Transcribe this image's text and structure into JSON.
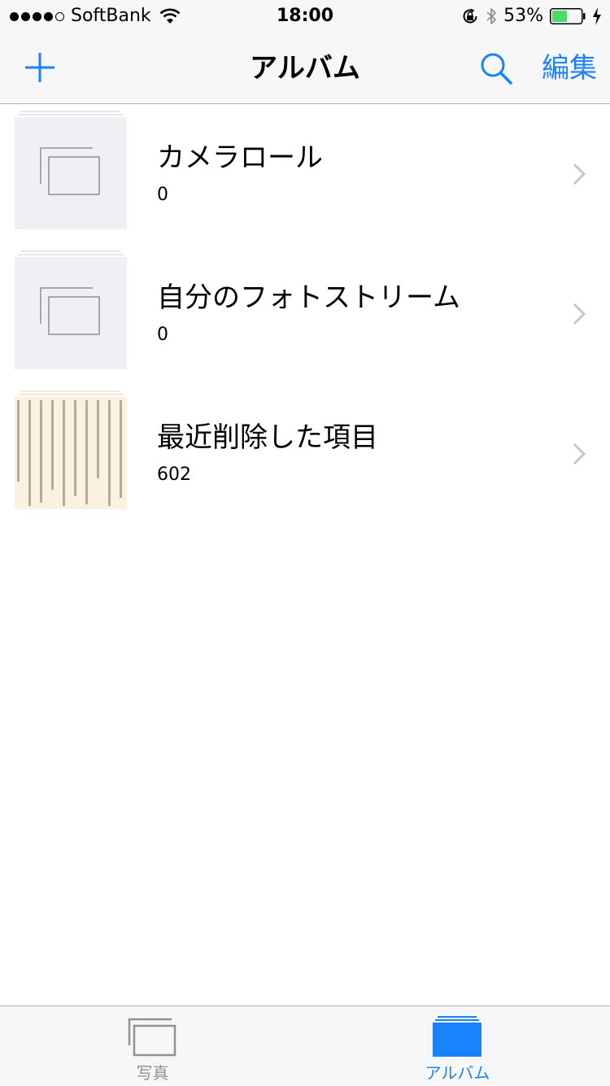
{
  "status_bar": {
    "carrier": "SoftBank",
    "time": "18:00",
    "battery_percent": "53%",
    "battery_level": 0.53,
    "signal_bars_filled": 4,
    "signal_bars_total": 5
  },
  "nav": {
    "title": "アルバム",
    "edit_label": "編集",
    "add_icon": "plus-icon",
    "search_icon": "search-icon"
  },
  "albums": [
    {
      "title": "カメラロール",
      "count": "0",
      "thumbnail": "placeholder"
    },
    {
      "title": "自分のフォトストリーム",
      "count": "0",
      "thumbnail": "placeholder"
    },
    {
      "title": "最近削除した項目",
      "count": "602",
      "thumbnail": "document-page"
    }
  ],
  "tab_bar": {
    "tabs": [
      {
        "label": "写真",
        "icon": "photos-tab-icon",
        "selected": false
      },
      {
        "label": "アルバム",
        "icon": "albums-tab-icon",
        "selected": true
      }
    ]
  },
  "colors": {
    "accent": "#1a82fb",
    "bar_background": "#f7f7f7",
    "inactive_tab": "#929292",
    "battery_fill": "#4cd964"
  }
}
